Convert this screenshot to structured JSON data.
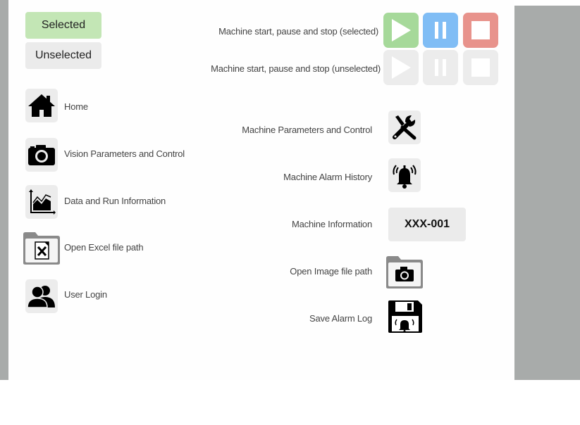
{
  "legend": {
    "selected_label": "Selected",
    "unselected_label": "Unselected"
  },
  "nav": [
    {
      "label": "Home",
      "icon": "home-icon"
    },
    {
      "label": "Vision Parameters and Control",
      "icon": "camera-icon"
    },
    {
      "label": "Data and Run Information",
      "icon": "area-chart-icon"
    },
    {
      "label": "Open Excel file path",
      "icon": "excel-folder-icon"
    },
    {
      "label": "User Login",
      "icon": "users-icon"
    }
  ],
  "machine_controls": {
    "selected_label": "Machine start, pause and stop (selected)",
    "unselected_label": "Machine start, pause and stop (unselected)",
    "colors": {
      "start": "#a6d99a",
      "pause": "#80bdf5",
      "stop": "#e8938c",
      "inactive": "#ececec"
    }
  },
  "actions": [
    {
      "label": "Machine Parameters and Control",
      "icon": "tools-icon"
    },
    {
      "label": "Machine Alarm History",
      "icon": "alarm-bell-icon"
    },
    {
      "label": "Machine Information",
      "icon": "machine-id-badge"
    },
    {
      "label": "Open Image file path",
      "icon": "image-folder-icon"
    },
    {
      "label": "Save Alarm Log",
      "icon": "save-alarm-icon"
    }
  ],
  "machine_info": {
    "id": "XXX-001"
  }
}
